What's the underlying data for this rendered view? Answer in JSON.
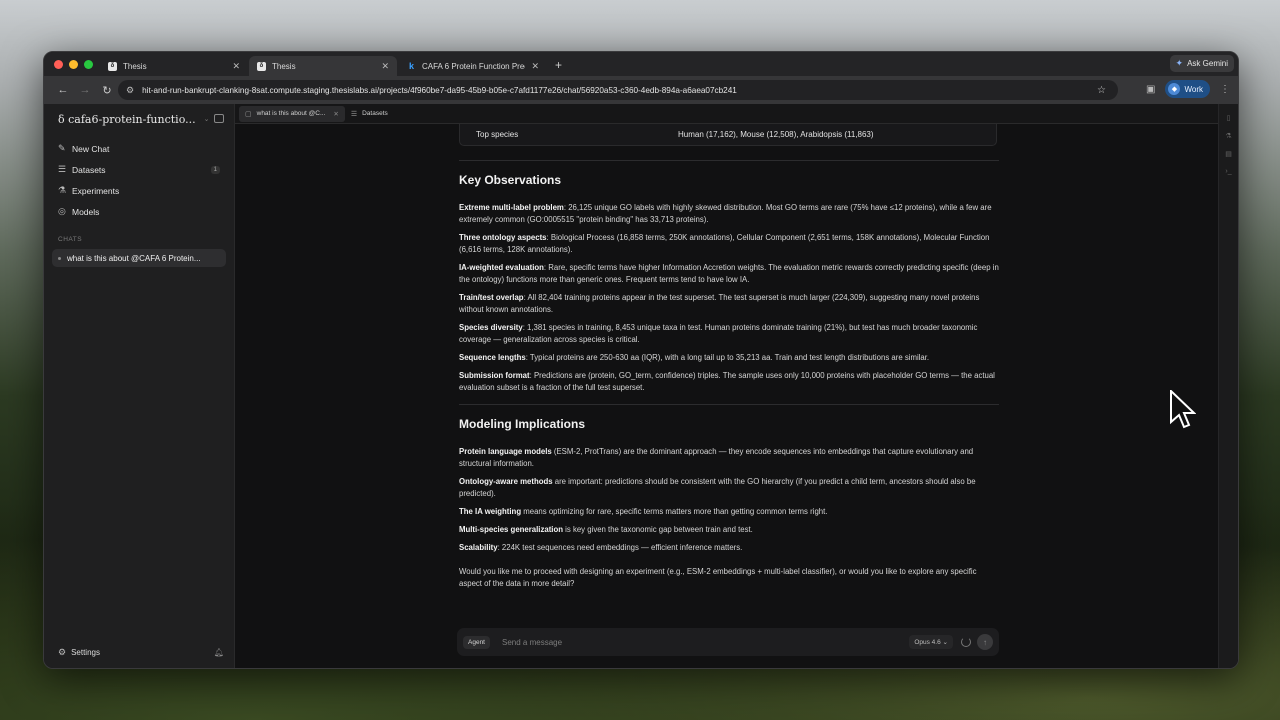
{
  "browser": {
    "tabs": [
      {
        "title": "Thesis",
        "favicon": "δ",
        "active": false
      },
      {
        "title": "Thesis",
        "favicon": "δ",
        "active": true
      },
      {
        "title": "CAFA 6 Protein Function Prec",
        "favicon": "k",
        "active": false
      }
    ],
    "ask_gemini": "Ask Gemini",
    "url": "hit-and-run-bankrupt-clanking-8sat.compute.staging.thesislabs.ai/projects/4f960be7-da95-45b9-b05e-c7afd1177e26/chat/56920a53-c360-4edb-894a-a6aea07cb241",
    "profile_label": "Work"
  },
  "sidebar": {
    "project_name": "cafa6-protein-functio...",
    "items": [
      {
        "label": "New Chat",
        "icon": "edit-icon"
      },
      {
        "label": "Datasets",
        "icon": "database-icon",
        "badge": "1"
      },
      {
        "label": "Experiments",
        "icon": "flask-icon"
      },
      {
        "label": "Models",
        "icon": "model-icon"
      }
    ],
    "chats_header": "CHATS",
    "chats": [
      "what is this about @CAFA 6 Protein..."
    ],
    "settings_label": "Settings"
  },
  "main_tabs": [
    {
      "label": "what is this about @C...",
      "active": true
    },
    {
      "label": "Datasets",
      "active": false
    }
  ],
  "content": {
    "top_species_label": "Top species",
    "top_species_value": "Human (17,162), Mouse (12,508), Arabidopsis (11,863)",
    "key_observations_title": "Key Observations",
    "observations": [
      {
        "bold": "Extreme multi-label problem",
        "text": ": 26,125 unique GO labels with highly skewed distribution. Most GO terms are rare (75% have ≤12 proteins), while a few are extremely common (GO:0005515 \"protein binding\" has 33,713 proteins)."
      },
      {
        "bold": "Three ontology aspects",
        "text": ": Biological Process (16,858 terms, 250K annotations), Cellular Component (2,651 terms, 158K annotations), Molecular Function (6,616 terms, 128K annotations)."
      },
      {
        "bold": "IA-weighted evaluation",
        "text": ": Rare, specific terms have higher Information Accretion weights. The evaluation metric rewards correctly predicting specific (deep in the ontology) functions more than generic ones. Frequent terms tend to have low IA."
      },
      {
        "bold": "Train/test overlap",
        "text": ": All 82,404 training proteins appear in the test superset. The test superset is much larger (224,309), suggesting many novel proteins without known annotations."
      },
      {
        "bold": "Species diversity",
        "text": ": 1,381 species in training, 8,453 unique taxa in test. Human proteins dominate training (21%), but test has much broader taxonomic coverage — generalization across species is critical."
      },
      {
        "bold": "Sequence lengths",
        "text": ": Typical proteins are 250-630 aa (IQR), with a long tail up to 35,213 aa. Train and test length distributions are similar."
      },
      {
        "bold": "Submission format",
        "text": ": Predictions are (protein, GO_term, confidence) triples. The sample uses only 10,000 proteins with placeholder GO terms — the actual evaluation subset is a fraction of the full test superset."
      }
    ],
    "modeling_title": "Modeling Implications",
    "implications": [
      {
        "bold": "Protein language models",
        "text": " (ESM-2, ProtTrans) are the dominant approach — they encode sequences into embeddings that capture evolutionary and structural information."
      },
      {
        "bold": "Ontology-aware methods",
        "text": " are important: predictions should be consistent with the GO hierarchy (if you predict a child term, ancestors should also be predicted)."
      },
      {
        "bold": "The IA weighting",
        "text": " means optimizing for rare, specific terms matters more than getting common terms right."
      },
      {
        "bold": "Multi-species generalization",
        "text": " is key given the taxonomic gap between train and test."
      },
      {
        "bold": "Scalability",
        "text": ": 224K test sequences need embeddings — efficient inference matters."
      }
    ],
    "closing_question": "Would you like me to proceed with designing an experiment (e.g., ESM-2 embeddings + multi-label classifier), or would you like to explore any specific aspect of the data in more detail?"
  },
  "composer": {
    "mode": "Agent",
    "placeholder": "Send a message",
    "model": "Opus 4.6"
  }
}
